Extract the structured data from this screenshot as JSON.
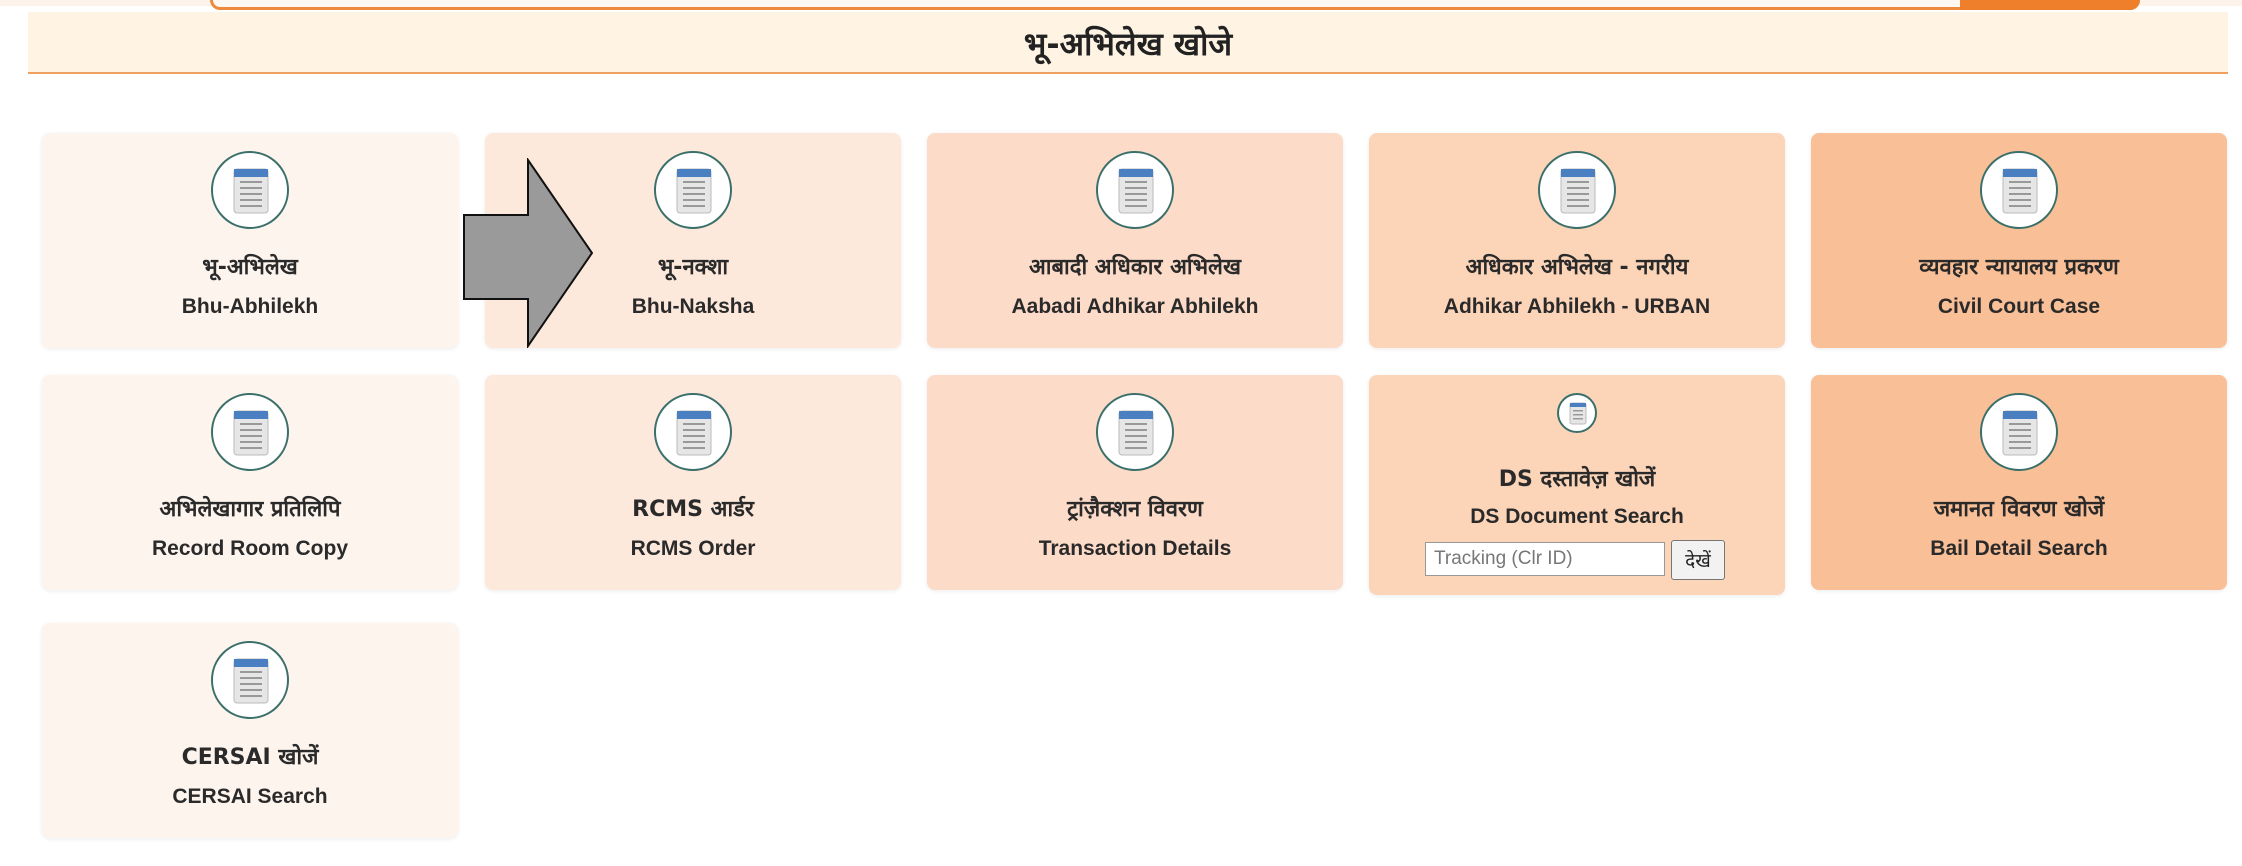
{
  "header": {
    "title": "भू-अभिलेख खोजे"
  },
  "cards": [
    {
      "hi": "भू-अभिलेख",
      "en": "Bhu-Abhilekh",
      "icon": "document-icon"
    },
    {
      "hi": "भू-नक्शा",
      "en": "Bhu-Naksha",
      "icon": "document-icon"
    },
    {
      "hi": "आबादी अधिकार अभिलेख",
      "en": "Aabadi Adhikar Abhilekh",
      "icon": "document-icon"
    },
    {
      "hi": "अधिकार अभिलेख - नगरीय",
      "en": "Adhikar Abhilekh - URBAN",
      "icon": "document-icon"
    },
    {
      "hi": "व्यवहार न्यायालय प्रकरण",
      "en": "Civil Court Case",
      "icon": "document-icon"
    },
    {
      "hi": "अभिलेखागार प्रतिलिपि",
      "en": "Record Room Copy",
      "icon": "document-icon"
    },
    {
      "hi": "RCMS आर्डर",
      "en": "RCMS Order",
      "icon": "document-icon"
    },
    {
      "hi": "ट्रांज़ैक्शन विवरण",
      "en": "Transaction Details",
      "icon": "document-icon"
    },
    {
      "hi": "DS दस्तावेज़ खोजें",
      "en": "DS Document Search",
      "icon": "document-icon"
    },
    {
      "hi": "जमानत विवरण खोजें",
      "en": "Bail Detail Search",
      "icon": "document-icon"
    },
    {
      "hi": "CERSAI खोजें",
      "en": "CERSAI Search",
      "icon": "document-icon"
    }
  ],
  "ds_search": {
    "placeholder": "Tracking (Clr ID)",
    "button_label": "देखें"
  },
  "colors": {
    "accent": "#ef7f2a",
    "header_bg": "#fff3e3",
    "card_shades": [
      "#fdf4ee",
      "#fde8dc",
      "#fcdcc8",
      "#fcd5b9",
      "#f9bf97"
    ],
    "pointer_arrow": "#9a9a9a"
  }
}
